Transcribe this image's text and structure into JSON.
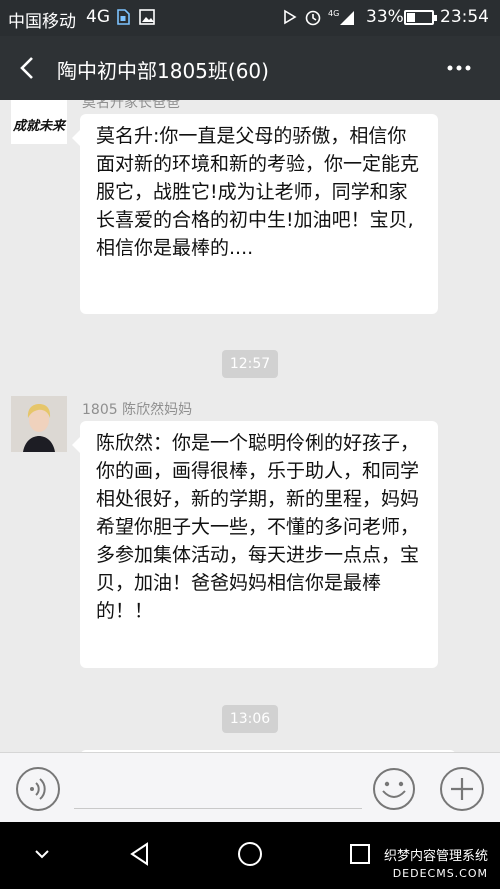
{
  "status_bar": {
    "carrier": "中国移动",
    "network": "4G",
    "signal_label": "4G",
    "battery_percent_text": "33%",
    "battery_level": 0.33,
    "time": "23:54",
    "icons": [
      "sim-icon",
      "image-icon",
      "nfc-icon",
      "alarm-icon",
      "signal-icon",
      "battery-icon"
    ]
  },
  "chat": {
    "title": "陶中初中部1805班(60)",
    "back_icon": "chevron-left-icon",
    "more_icon": "more-dots-icon"
  },
  "messages": [
    {
      "sender": "莫名升家长爸爸",
      "avatar_text": "成就未来",
      "text": "莫名升:你一直是父母的骄傲，相信你面对新的环境和新的考验，你一定能克服它，战胜它!成为让老师，同学和家长喜爱的合格的初中生!加油吧！宝贝,相信你是最棒的...."
    },
    {
      "timestamp": "12:57"
    },
    {
      "sender": "1805 陈欣然妈妈",
      "text": "陈欣然：你是一个聪明伶俐的好孩子，你的画，画得很棒，乐于助人，和同学相处很好，新的学期，新的里程，妈妈希望你胆子大一些，不懂的多问老师，多参加集体活动，每天进步一点点，宝贝，加油！爸爸妈妈相信你是最棒的！！"
    },
    {
      "timestamp": "13:06"
    }
  ],
  "input_bar": {
    "voice_icon": "voice-icon",
    "emoji_icon": "emoji-icon",
    "plus_icon": "plus-icon"
  },
  "nav_bar": {
    "icons": [
      "chevron-down-icon",
      "back-triangle-icon",
      "home-circle-icon",
      "recents-square-icon"
    ]
  },
  "watermark": {
    "line1": "织梦内容管理系统",
    "line2": "DEDECMS.COM"
  },
  "colors": {
    "status_bg": "#2a2e31",
    "title_bg": "#2e3235",
    "chat_bg": "#ebebeb",
    "bubble_bg": "#ffffff",
    "timestamp_bg": "#d1d1d1"
  }
}
